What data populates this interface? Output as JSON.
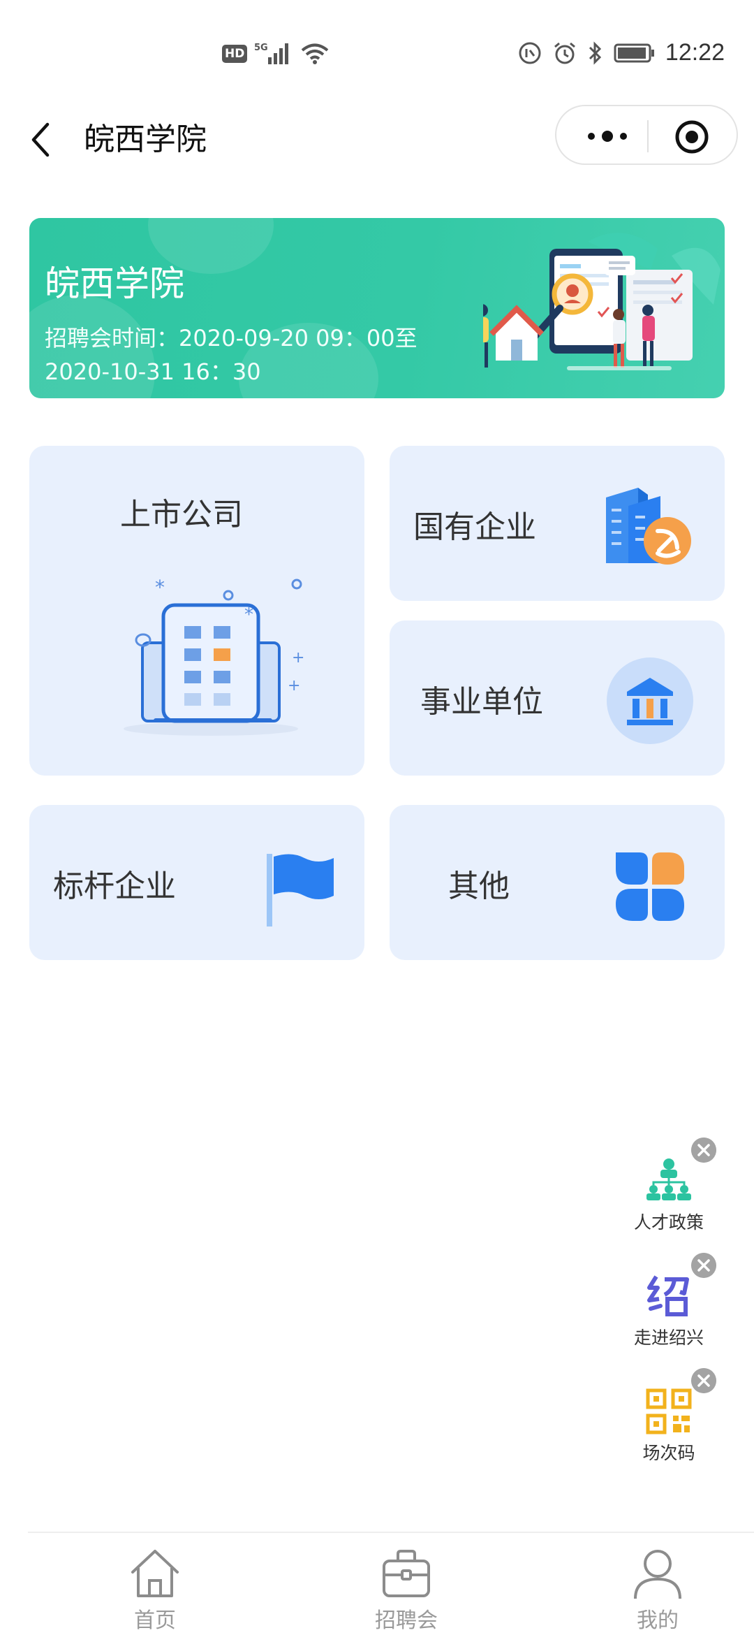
{
  "status_bar": {
    "hd_badge": "HD",
    "network_label": "5G",
    "time": "12:22"
  },
  "nav": {
    "title": "皖西学院"
  },
  "banner": {
    "title": "皖西学院",
    "time_text": "招聘会时间：2020-09-20 09：00至2020-10-31 16：30"
  },
  "categories": {
    "listed": "上市公司",
    "soe": "国有企业",
    "institution": "事业单位",
    "benchmark": "标杆企业",
    "other": "其他"
  },
  "floating": {
    "talent_policy": "人才政策",
    "shaoxing": "走进绍兴",
    "venue_code": "场次码"
  },
  "tabs": {
    "home": "首页",
    "job_fair": "招聘会",
    "mine": "我的"
  },
  "colors": {
    "banner": "#34c9a6",
    "card_bg": "#e8f0fd",
    "accent_blue": "#2a8bf2",
    "accent_orange": "#f5a04a",
    "tab_gray": "#9a9a9a"
  }
}
